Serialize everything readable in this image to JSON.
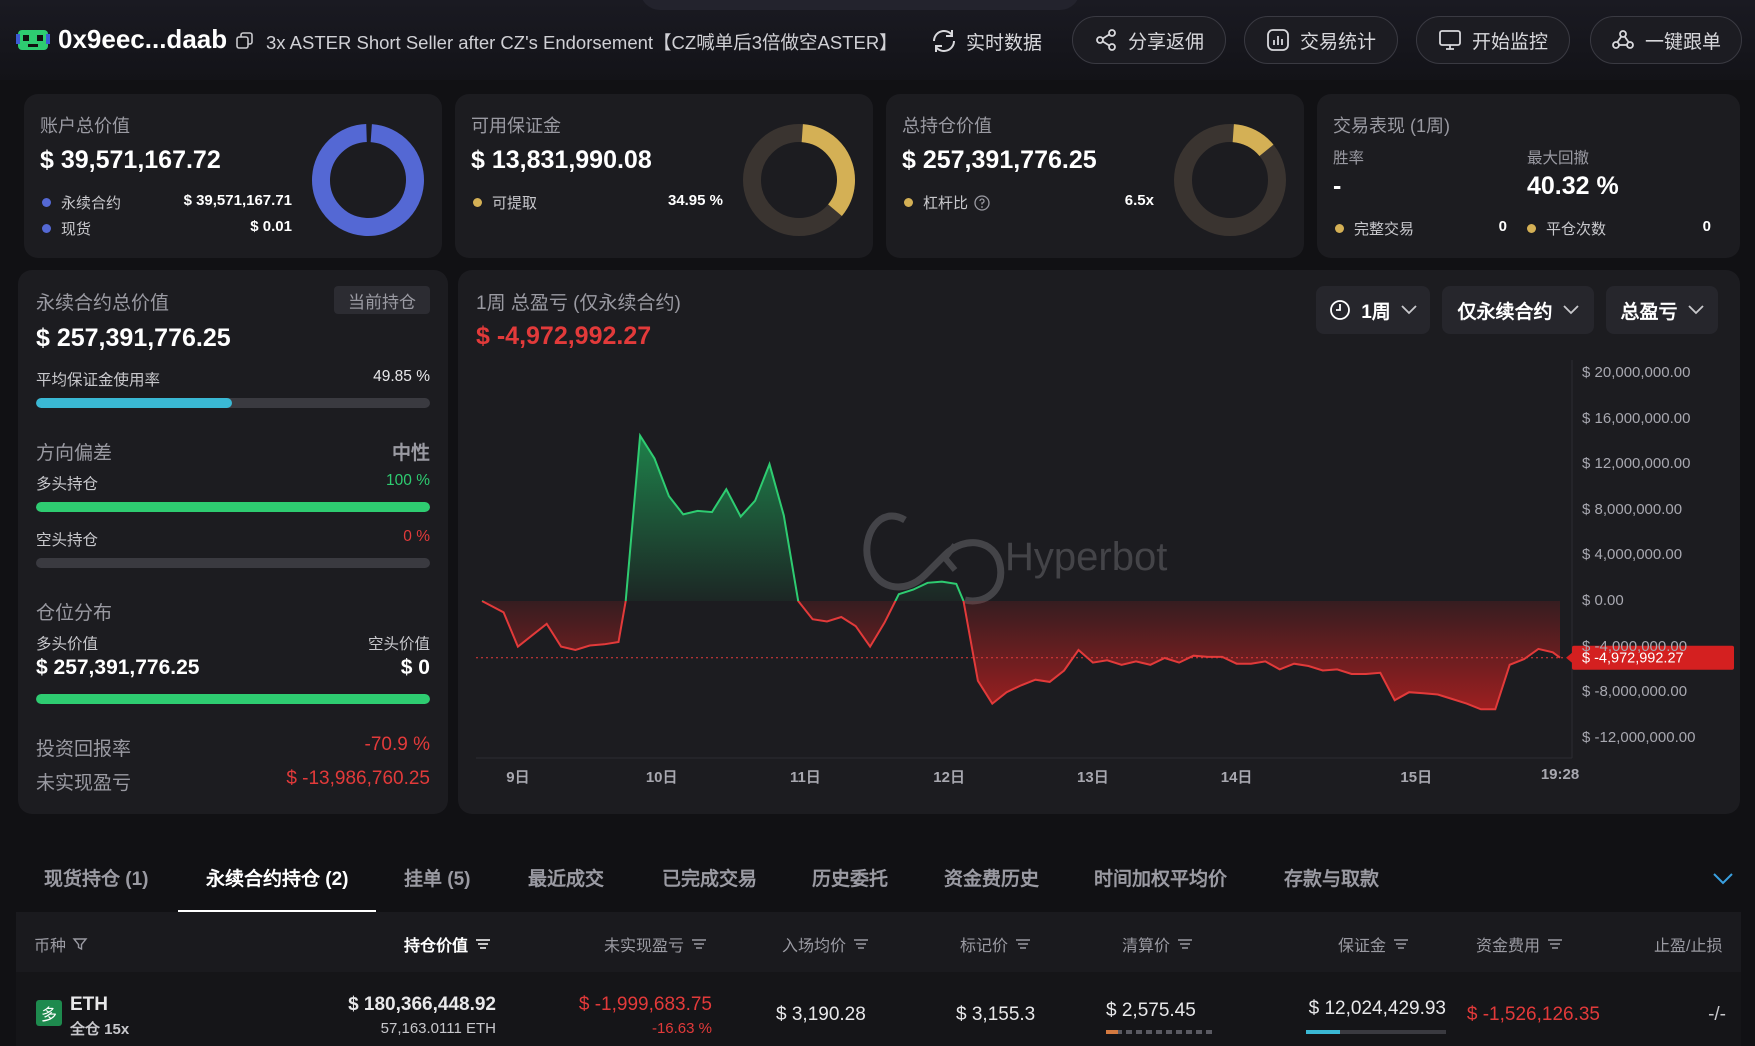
{
  "header": {
    "address": "0x9eec...daab",
    "subtitle": "3x ASTER Short Seller after CZ's Endorsement【CZ喊单后3倍做空ASTER】",
    "realtime_label": "实时数据",
    "buttons": [
      {
        "label": "分享返佣",
        "icon": "share-icon"
      },
      {
        "label": "交易统计",
        "icon": "stats-icon"
      },
      {
        "label": "开始监控",
        "icon": "monitor-icon"
      },
      {
        "label": "一键跟单",
        "icon": "copytrade-icon"
      }
    ]
  },
  "account_card": {
    "label": "账户总价值",
    "value": "$ 39,571,167.72",
    "legend": [
      {
        "name": "永续合约",
        "value": "$ 39,571,167.71",
        "color": "#5468d4"
      },
      {
        "name": "现货",
        "value": "$ 0.01",
        "color": "#5468d4"
      }
    ]
  },
  "margin_card": {
    "label": "可用保证金",
    "value": "$ 13,831,990.08",
    "legend_name": "可提取",
    "legend_value": "34.95 %",
    "fraction": 0.3495,
    "color": "#d4b055"
  },
  "position_card": {
    "label": "总持仓价值",
    "value": "$ 257,391,776.25",
    "legend_name": "杠杆比",
    "legend_value": "6.5x",
    "fraction": 0.13,
    "color": "#d4b055"
  },
  "performance_card": {
    "label": "交易表现 (1周)",
    "win_rate_label": "胜率",
    "win_rate_value": "-",
    "drawdown_label": "最大回撤",
    "drawdown_value": "40.32 %",
    "completed_label": "完整交易",
    "completed_value": "0",
    "close_label": "平仓次数",
    "close_value": "0"
  },
  "left_panel": {
    "perp_label": "永续合约总价值",
    "current_badge": "当前持仓",
    "perp_value": "$ 257,391,776.25",
    "margin_usage_label": "平均保证金使用率",
    "margin_usage_value": "49.85 %",
    "margin_usage_fraction": 0.4985,
    "direction_label": "方向偏差",
    "direction_value": "中性",
    "long_label": "多头持仓",
    "long_value": "100 %",
    "long_fraction": 1.0,
    "short_label": "空头持仓",
    "short_value": "0 %",
    "short_fraction": 0.0,
    "distribution_label": "仓位分布",
    "long_value_label": "多头价值",
    "short_value_label": "空头价值",
    "long_amount": "$ 257,391,776.25",
    "short_amount": "$ 0",
    "distribution_fraction": 1.0,
    "roi_label": "投资回报率",
    "roi_value": "-70.9 %",
    "upnl_label": "未实现盈亏",
    "upnl_value": "$ -13,986,760.25"
  },
  "chart_panel": {
    "title": "1周 总盈亏 (仅永续合约)",
    "value": "$ -4,972,992.27",
    "dropdowns": [
      "1周",
      "仅永续合约",
      "总盈亏"
    ],
    "watermark": "Hyperbot",
    "current_label": "$ -4,972,992.27"
  },
  "chart_data": {
    "type": "area",
    "title": "1周 总盈亏 (仅永续合约)",
    "xlabel": "",
    "ylabel": "",
    "ylim": [
      -14000000,
      22000000
    ],
    "y_ticks": [
      {
        "value": 20000000,
        "label": "$ 20,000,000.00"
      },
      {
        "value": 16000000,
        "label": "$ 16,000,000.00"
      },
      {
        "value": 12000000,
        "label": "$ 12,000,000.00"
      },
      {
        "value": 8000000,
        "label": "$ 8,000,000.00"
      },
      {
        "value": 4000000,
        "label": "$ 4,000,000.00"
      },
      {
        "value": 0,
        "label": "$ 0.00"
      },
      {
        "value": -4000000,
        "label": "$ -4,000,000.00"
      },
      {
        "value": -8000000,
        "label": "$ -8,000,000.00"
      },
      {
        "value": -12000000,
        "label": "$ -12,000,000.00"
      }
    ],
    "x_ticks": [
      {
        "value": 0.25,
        "label": "9日"
      },
      {
        "value": 1.25,
        "label": "10日"
      },
      {
        "value": 2.25,
        "label": "11日"
      },
      {
        "value": 3.25,
        "label": "12日"
      },
      {
        "value": 4.25,
        "label": "13日"
      },
      {
        "value": 5.25,
        "label": "14日"
      },
      {
        "value": 6.5,
        "label": "15日"
      },
      {
        "value": 7.5,
        "label": "19:28"
      }
    ],
    "series": [
      {
        "values": [
          [
            0.0,
            0.0
          ],
          [
            0.15,
            -1.0
          ],
          [
            0.25,
            -4.0
          ],
          [
            0.35,
            -3.0
          ],
          [
            0.45,
            -2.0
          ],
          [
            0.55,
            -4.0
          ],
          [
            0.65,
            -4.3
          ],
          [
            0.75,
            -3.9
          ],
          [
            0.85,
            -3.8
          ],
          [
            0.95,
            -3.6
          ],
          [
            1.0,
            0.0
          ],
          [
            1.1,
            14.5
          ],
          [
            1.2,
            12.5
          ],
          [
            1.3,
            9.2
          ],
          [
            1.4,
            7.6
          ],
          [
            1.5,
            7.9
          ],
          [
            1.6,
            7.8
          ],
          [
            1.7,
            9.8
          ],
          [
            1.8,
            7.4
          ],
          [
            1.9,
            8.8
          ],
          [
            2.0,
            12.0
          ],
          [
            2.1,
            7.5
          ],
          [
            2.2,
            0.0
          ],
          [
            2.3,
            -1.6
          ],
          [
            2.4,
            -1.8
          ],
          [
            2.5,
            -1.4
          ],
          [
            2.6,
            -2.2
          ],
          [
            2.7,
            -4.0
          ],
          [
            2.8,
            -1.9
          ],
          [
            2.9,
            0.6
          ],
          [
            3.0,
            1.0
          ],
          [
            3.1,
            1.6
          ],
          [
            3.2,
            1.7
          ],
          [
            3.3,
            1.5
          ],
          [
            3.35,
            0.0
          ],
          [
            3.45,
            -7.0
          ],
          [
            3.55,
            -9.0
          ],
          [
            3.65,
            -8.0
          ],
          [
            3.75,
            -7.4
          ],
          [
            3.85,
            -6.9
          ],
          [
            3.95,
            -7.1
          ],
          [
            4.05,
            -6.1
          ],
          [
            4.15,
            -4.3
          ],
          [
            4.25,
            -5.4
          ],
          [
            4.35,
            -5.2
          ],
          [
            4.45,
            -5.6
          ],
          [
            4.55,
            -5.3
          ],
          [
            4.65,
            -5.6
          ],
          [
            4.75,
            -5.0
          ],
          [
            4.85,
            -5.4
          ],
          [
            4.95,
            -4.8
          ],
          [
            5.05,
            -4.9
          ],
          [
            5.15,
            -4.9
          ],
          [
            5.25,
            -5.5
          ],
          [
            5.35,
            -5.5
          ],
          [
            5.45,
            -5.3
          ],
          [
            5.55,
            -6.0
          ],
          [
            5.65,
            -5.5
          ],
          [
            5.75,
            -5.7
          ],
          [
            5.85,
            -6.1
          ],
          [
            5.95,
            -6.0
          ],
          [
            6.05,
            -6.4
          ],
          [
            6.15,
            -6.4
          ],
          [
            6.25,
            -6.3
          ],
          [
            6.35,
            -8.7
          ],
          [
            6.45,
            -8.0
          ],
          [
            6.55,
            -8.1
          ],
          [
            6.65,
            -8.2
          ],
          [
            6.75,
            -8.6
          ],
          [
            6.85,
            -9.0
          ],
          [
            6.95,
            -9.5
          ],
          [
            7.05,
            -9.5
          ],
          [
            7.15,
            -5.6
          ],
          [
            7.25,
            -5.1
          ],
          [
            7.35,
            -4.2
          ],
          [
            7.45,
            -4.5
          ],
          [
            7.5,
            -4.97
          ]
        ],
        "unit": "millions"
      }
    ],
    "current_value": -4972992.27,
    "grid": false
  },
  "tabs": [
    {
      "label": "现货持仓 (1)",
      "active": false
    },
    {
      "label": "永续合约持仓 (2)",
      "active": true
    },
    {
      "label": "挂单 (5)",
      "active": false
    },
    {
      "label": "最近成交",
      "active": false
    },
    {
      "label": "已完成交易",
      "active": false
    },
    {
      "label": "历史委托",
      "active": false
    },
    {
      "label": "资金费历史",
      "active": false
    },
    {
      "label": "时间加权平均价",
      "active": false
    },
    {
      "label": "存款与取款",
      "active": false
    }
  ],
  "table": {
    "headers": [
      "币种",
      "持仓价值",
      "未实现盈亏",
      "入场均价",
      "标记价",
      "清算价",
      "保证金",
      "资金费用",
      "止盈/止损"
    ],
    "rows": [
      {
        "coin": "ETH",
        "mode": "全仓 15x",
        "badge": "多",
        "value": "$ 180,366,448.92",
        "size": "57,163.0111 ETH",
        "upnl": "$ -1,999,683.75",
        "upnl_pct": "-16.63 %",
        "entry": "$ 3,190.28",
        "mark": "$ 3,155.3",
        "liq": "$ 2,575.45",
        "margin": "$ 12,024,429.93",
        "funding": "$ -1,526,126.35",
        "tpsl": "-/-"
      }
    ]
  }
}
